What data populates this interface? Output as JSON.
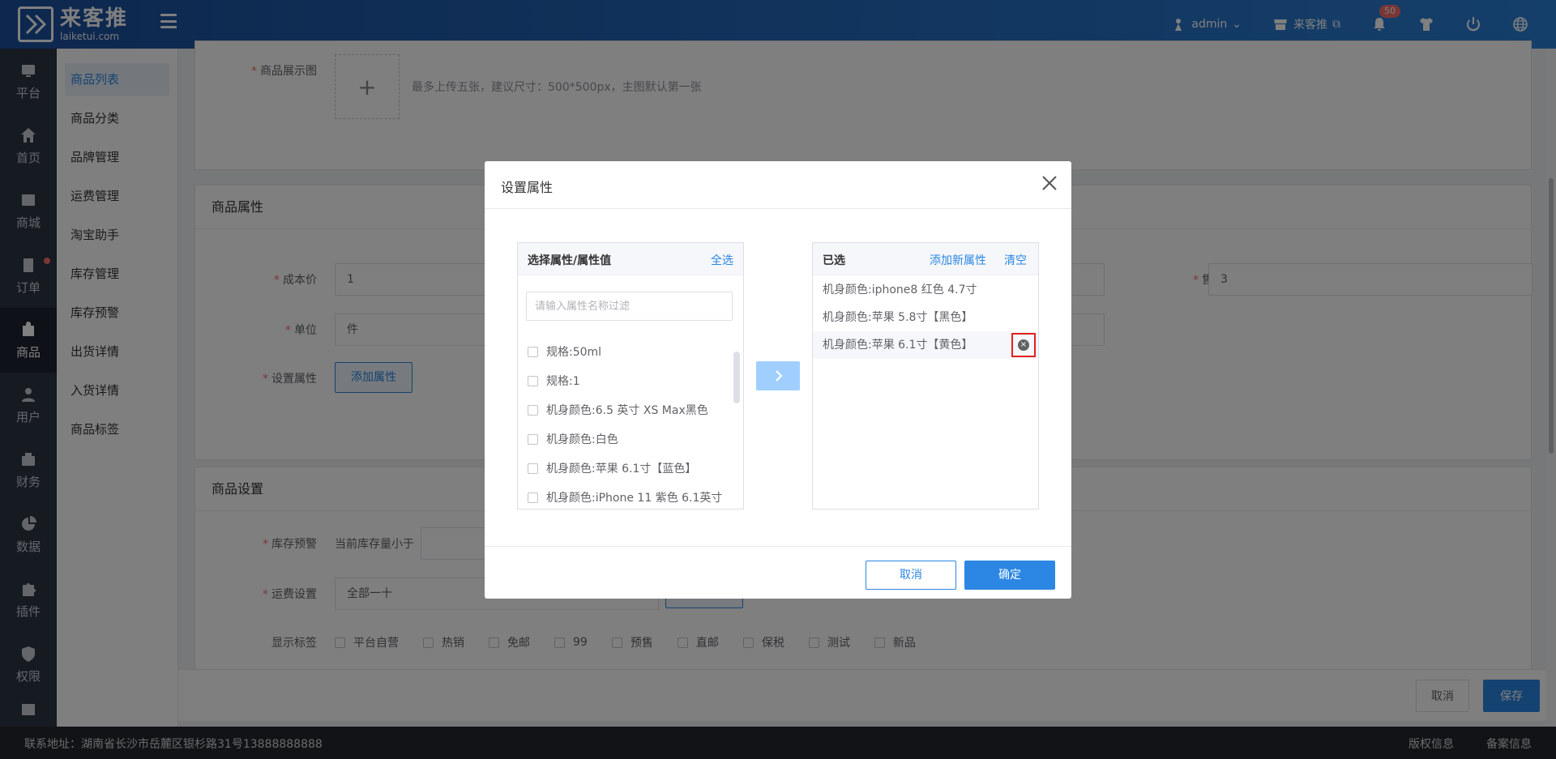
{
  "header": {
    "logo_name": "来客推",
    "logo_sub": "laiketui.com",
    "user": "admin",
    "shop": "来客推",
    "notification_count": "50"
  },
  "leftnav": [
    {
      "label": "平台",
      "icon": "platform-icon"
    },
    {
      "label": "首页",
      "icon": "home-icon"
    },
    {
      "label": "商城",
      "icon": "mall-icon"
    },
    {
      "label": "订单",
      "icon": "order-icon"
    },
    {
      "label": "商品",
      "icon": "product-icon"
    },
    {
      "label": "用户",
      "icon": "user-icon"
    },
    {
      "label": "财务",
      "icon": "finance-icon"
    },
    {
      "label": "数据",
      "icon": "data-icon"
    },
    {
      "label": "插件",
      "icon": "plugin-icon"
    },
    {
      "label": "权限",
      "icon": "permission-icon"
    }
  ],
  "subnav": [
    "商品列表",
    "商品分类",
    "品牌管理",
    "运费管理",
    "淘宝助手",
    "库存管理",
    "库存预警",
    "出货详情",
    "入货详情",
    "商品标签"
  ],
  "form": {
    "image_label": "商品展示图",
    "image_hint": "最多上传五张，建议尺寸：500*500px，主图默认第一张",
    "attr_section": "商品属性",
    "cost_label": "成本价",
    "cost_value": "1",
    "price_label": "售价",
    "price_value": "3",
    "unit_label": "单位",
    "unit_value": "件",
    "set_attr_label": "设置属性",
    "add_attr_button": "添加属性",
    "settings_section": "商品设置",
    "stock_warn_label": "库存预警",
    "stock_warn_text": "当前库存量小于",
    "shipping_label": "运费设置",
    "shipping_value": "全部一十",
    "tags_label": "显示标签",
    "tags": [
      "平台自营",
      "热销",
      "免邮",
      "99",
      "预售",
      "直邮",
      "保税",
      "测试",
      "新品"
    ]
  },
  "bottom": {
    "cancel": "取消",
    "save": "保存"
  },
  "footer": {
    "address": "联系地址：湖南省长沙市岳麓区银杉路31号13888888888",
    "links": [
      "版权信息",
      "备案信息"
    ]
  },
  "modal": {
    "title": "设置属性",
    "left_title": "选择属性/属性值",
    "select_all": "全选",
    "filter_placeholder": "请输入属性名称过滤",
    "options": [
      "规格:50ml",
      "规格:1",
      "机身颜色:6.5 英寸 XS Max黑色",
      "机身颜色:白色",
      "机身颜色:苹果 6.1寸【蓝色】",
      "机身颜色:iPhone 11 紫色 6.1英寸"
    ],
    "right_title": "已选",
    "add_new_attr": "添加新属性",
    "clear": "清空",
    "selected": [
      "机身颜色:iphone8 红色 4.7寸",
      "机身颜色:苹果 5.8寸【黑色】",
      "机身颜色:苹果 6.1寸【黄色】"
    ],
    "cancel": "取消",
    "confirm": "确定"
  }
}
